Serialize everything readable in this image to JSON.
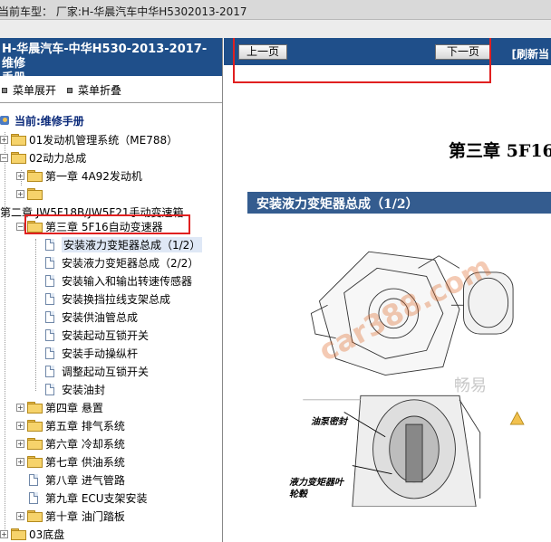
{
  "topbar": {
    "text": "当前车型：  厂家:H-华晨汽车中华H5302013-2017"
  },
  "sidebar": {
    "title_line1": "H-华晨汽车-中华H530-2013-2017- 维修",
    "title_line2": "手册.",
    "expand_label": "菜单展开",
    "collapse_label": "菜单折叠",
    "current": "当前:维修手册",
    "items": [
      "01发动机管理系统（ME788）",
      "02动力总成",
      "第一章 4A92发动机",
      "",
      "第二章 JW5F18B/JW5F21手动变速箱",
      "第三章 5F16自动变速器",
      "安装液力变矩器总成（1/2）",
      "安装液力变矩器总成（2/2）",
      "安装输入和输出转速传感器",
      "安装换挡拉线支架总成",
      "安装供油管总成",
      "安装起动互锁开关",
      "安装手动操纵杆",
      "调整起动互锁开关",
      "安装油封",
      "第四章 悬置",
      "第五章 排气系统",
      "第六章 冷却系统",
      "第七章 供油系统",
      "第八章 进气管路",
      "第九章 ECU支架安装",
      "第十章 油门踏板",
      "03底盘"
    ]
  },
  "toolbar": {
    "prev_label": "上一页",
    "next_label": "下一页",
    "refresh_label": "[刷新当"
  },
  "document": {
    "chapter_title": "第三章  5F16",
    "section_banner": "安装液力变矩器总成（1/2）",
    "label_oil_seal": "油泵密封",
    "label_hub_line1": "液力变矩器叶",
    "label_hub_line2": "轮毂",
    "watermark": "car388.com",
    "watermark_cn": "畅易"
  },
  "colors": {
    "header_blue": "#1f4f8a",
    "highlight_red": "#e02020",
    "banner_blue": "#345c8f"
  }
}
